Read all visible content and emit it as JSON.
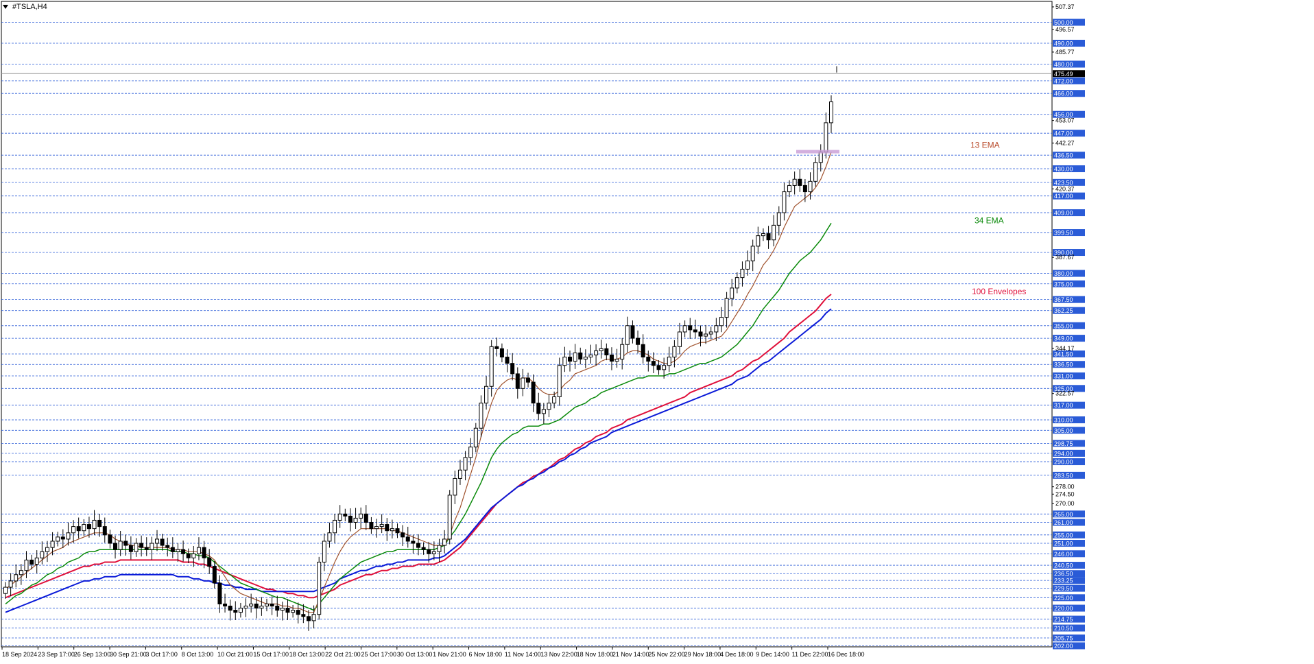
{
  "window": {
    "title": "#TSLA,H4"
  },
  "colors": {
    "grid": "#2a5bd7",
    "label_bg": "#2a5bd7",
    "ema13": "#a0522d",
    "ema34": "#0a8a0a",
    "env_upper": "#e0103a",
    "env_lower": "#0a1ad8",
    "candle": "#000000",
    "zone": "#c79bd6"
  },
  "annotations": [
    {
      "text": "13 EMA",
      "color": "#b84a2a"
    },
    {
      "text": "34 EMA",
      "color": "#0a8a0a"
    },
    {
      "text": "100 Envelopes",
      "color": "#e0103a"
    }
  ],
  "chart_data": {
    "type": "candlestick",
    "symbol": "#TSLA",
    "timeframe": "H4",
    "ylim": [
      201.5,
      510
    ],
    "current_price": "475.49",
    "y_levels_highlighted": [
      202.0,
      205.75,
      210.5,
      214.75,
      220.0,
      225.0,
      229.5,
      233.25,
      236.5,
      240.5,
      246.0,
      251.0,
      255.0,
      261.0,
      265.0,
      283.5,
      290.0,
      294.0,
      298.75,
      305.0,
      310.0,
      317.0,
      325.0,
      331.0,
      336.5,
      341.5,
      349.0,
      355.0,
      362.25,
      367.5,
      375.0,
      380.0,
      390.0,
      399.5,
      409.0,
      417.0,
      423.5,
      430.0,
      436.5,
      447.0,
      456.0,
      466.0,
      472.0,
      480.0,
      490.0,
      500.0
    ],
    "y_levels_plain": [
      "507.37",
      "496.57",
      "485.77",
      "453.07",
      "442.27",
      "420.37",
      "387.67",
      "344.17",
      "322.57",
      "270.00",
      "274.50",
      "278.00"
    ],
    "x_tick_labels": [
      "18 Sep 2024",
      "23 Sep 17:00",
      "26 Sep 13:00",
      "30 Sep 21:00",
      "3 Oct 17:00",
      "8 Oct 13:00",
      "10 Oct 21:00",
      "15 Oct 17:00",
      "18 Oct 13:00",
      "22 Oct 21:00",
      "25 Oct 17:00",
      "30 Oct 13:00",
      "1 Nov 21:00",
      "6 Nov 18:00",
      "11 Nov 14:00",
      "13 Nov 22:00",
      "18 Nov 18:00",
      "21 Nov 14:00",
      "25 Nov 22:00",
      "29 Nov 18:00",
      "4 Dec 18:00",
      "9 Dec 14:00",
      "11 Dec 22:00",
      "16 Dec 18:00"
    ],
    "close_series": [
      230,
      233,
      236,
      238,
      243,
      241,
      244,
      247,
      249,
      252,
      254,
      253,
      256,
      259,
      257,
      260,
      258,
      262,
      259,
      255,
      251,
      248,
      252,
      250,
      247,
      251,
      249,
      248,
      251,
      253,
      250,
      249,
      247,
      248,
      246,
      244,
      246,
      249,
      244,
      240,
      232,
      222,
      221,
      219,
      218,
      220,
      221,
      222,
      220,
      221,
      222,
      221,
      219,
      220,
      218,
      219,
      217,
      216,
      214,
      217,
      242,
      252,
      256,
      262,
      265,
      264,
      261,
      263,
      265,
      261,
      258,
      259,
      260,
      257,
      258,
      256,
      254,
      252,
      251,
      249,
      248,
      246,
      247,
      250,
      253,
      274,
      282,
      286,
      292,
      297,
      306,
      318,
      326,
      345,
      344,
      340,
      337,
      332,
      325,
      330,
      328,
      318,
      313,
      315,
      318,
      321,
      336,
      340,
      338,
      342,
      339,
      340,
      341,
      343,
      344,
      341,
      338,
      339,
      346,
      355,
      349,
      346,
      340,
      338,
      336,
      334,
      336,
      340,
      345,
      352,
      355,
      353,
      352,
      350,
      351,
      352,
      355,
      359,
      368,
      373,
      378,
      382,
      386,
      393,
      398,
      399,
      396,
      403,
      409,
      419,
      422,
      425,
      422,
      419,
      424,
      433,
      438,
      452,
      462
    ],
    "ema13_series": [
      229,
      231,
      233,
      235,
      237,
      239,
      241,
      243,
      245,
      247,
      248,
      249,
      251,
      252,
      253,
      254,
      255,
      256,
      256,
      256,
      255,
      253,
      252,
      251,
      250,
      250,
      249,
      249,
      249,
      249,
      249,
      249,
      248,
      248,
      248,
      247,
      247,
      247,
      246,
      245,
      243,
      239,
      235,
      231,
      229,
      227,
      226,
      225,
      224,
      223,
      222,
      222,
      222,
      221,
      221,
      220,
      220,
      219,
      218,
      218,
      224,
      230,
      236,
      242,
      247,
      251,
      254,
      256,
      258,
      258,
      258,
      258,
      258,
      258,
      257,
      257,
      256,
      255,
      254,
      253,
      252,
      251,
      250,
      250,
      250,
      255,
      262,
      268,
      276,
      284,
      292,
      302,
      310,
      318,
      324,
      327,
      329,
      330,
      329,
      330,
      330,
      328,
      325,
      323,
      322,
      322,
      324,
      327,
      329,
      332,
      333,
      334,
      335,
      336,
      338,
      339,
      339,
      339,
      340,
      342,
      343,
      343,
      342,
      341,
      339,
      338,
      337,
      337,
      338,
      340,
      343,
      345,
      346,
      347,
      347,
      348,
      349,
      350,
      353,
      357,
      361,
      365,
      370,
      374,
      379,
      384,
      387,
      391,
      396,
      402,
      407,
      412,
      414,
      416,
      418,
      421,
      425,
      431,
      438
    ],
    "ema34_series": [
      222,
      224,
      226,
      227,
      229,
      231,
      232,
      234,
      236,
      237,
      239,
      240,
      242,
      243,
      244,
      246,
      247,
      247,
      248,
      248,
      248,
      248,
      248,
      248,
      248,
      248,
      248,
      248,
      248,
      248,
      248,
      248,
      247,
      247,
      247,
      246,
      246,
      245,
      245,
      244,
      242,
      240,
      238,
      236,
      234,
      232,
      231,
      230,
      229,
      228,
      227,
      226,
      225,
      225,
      224,
      223,
      222,
      221,
      220,
      219,
      222,
      225,
      228,
      231,
      234,
      236,
      238,
      240,
      242,
      243,
      244,
      245,
      246,
      247,
      247,
      248,
      248,
      248,
      248,
      248,
      248,
      248,
      248,
      249,
      250,
      254,
      257,
      261,
      265,
      270,
      275,
      280,
      286,
      292,
      296,
      299,
      301,
      303,
      304,
      306,
      307,
      307,
      307,
      308,
      308,
      309,
      310,
      312,
      314,
      316,
      317,
      318,
      320,
      321,
      323,
      324,
      325,
      326,
      327,
      328,
      329,
      330,
      330,
      331,
      331,
      331,
      331,
      332,
      332,
      333,
      334,
      335,
      336,
      337,
      337,
      338,
      339,
      340,
      342,
      344,
      346,
      349,
      352,
      355,
      359,
      363,
      366,
      369,
      372,
      376,
      380,
      383,
      386,
      388,
      390,
      393,
      396,
      400,
      404
    ],
    "env_upper_series": [
      225,
      226,
      227,
      228,
      229,
      230,
      231,
      232,
      233,
      234,
      235,
      236,
      237,
      238,
      239,
      240,
      240,
      241,
      241,
      242,
      242,
      242,
      243,
      243,
      243,
      243,
      243,
      243,
      243,
      243,
      243,
      243,
      243,
      243,
      242,
      242,
      242,
      241,
      241,
      240,
      239,
      238,
      237,
      236,
      235,
      234,
      233,
      232,
      231,
      230,
      229,
      229,
      228,
      228,
      227,
      227,
      226,
      226,
      225,
      225,
      226,
      227,
      228,
      229,
      231,
      232,
      233,
      234,
      235,
      236,
      236,
      237,
      238,
      238,
      239,
      239,
      240,
      240,
      240,
      241,
      241,
      241,
      241,
      242,
      243,
      245,
      247,
      249,
      252,
      255,
      258,
      261,
      264,
      267,
      270,
      272,
      274,
      276,
      278,
      280,
      281,
      283,
      284,
      286,
      287,
      289,
      291,
      292,
      294,
      296,
      297,
      299,
      300,
      302,
      303,
      304,
      306,
      307,
      308,
      310,
      311,
      312,
      313,
      314,
      315,
      316,
      317,
      318,
      319,
      320,
      321,
      323,
      324,
      325,
      326,
      327,
      328,
      329,
      330,
      331,
      333,
      334,
      336,
      338,
      339,
      341,
      343,
      345,
      347,
      349,
      352,
      354,
      356,
      358,
      360,
      362,
      365,
      368,
      370
    ],
    "env_lower_series": [
      218,
      219,
      220,
      221,
      222,
      223,
      224,
      225,
      226,
      227,
      228,
      229,
      230,
      231,
      232,
      233,
      233,
      234,
      234,
      235,
      235,
      235,
      236,
      236,
      236,
      236,
      236,
      236,
      236,
      236,
      236,
      236,
      236,
      235,
      235,
      235,
      234,
      234,
      233,
      233,
      232,
      232,
      231,
      231,
      230,
      230,
      229,
      229,
      229,
      228,
      228,
      228,
      228,
      228,
      228,
      228,
      228,
      228,
      228,
      228,
      229,
      230,
      231,
      232,
      234,
      235,
      236,
      237,
      238,
      238,
      239,
      240,
      240,
      241,
      241,
      242,
      242,
      243,
      243,
      243,
      243,
      243,
      244,
      244,
      245,
      247,
      249,
      251,
      253,
      256,
      259,
      262,
      265,
      268,
      270,
      272,
      274,
      276,
      278,
      279,
      281,
      282,
      284,
      285,
      287,
      288,
      290,
      291,
      293,
      294,
      296,
      297,
      299,
      300,
      301,
      302,
      304,
      305,
      306,
      307,
      308,
      309,
      310,
      311,
      312,
      313,
      314,
      315,
      316,
      317,
      318,
      319,
      320,
      321,
      322,
      323,
      324,
      325,
      326,
      327,
      329,
      330,
      331,
      333,
      335,
      337,
      338,
      340,
      342,
      344,
      346,
      348,
      350,
      352,
      354,
      356,
      358,
      361,
      363
    ]
  }
}
